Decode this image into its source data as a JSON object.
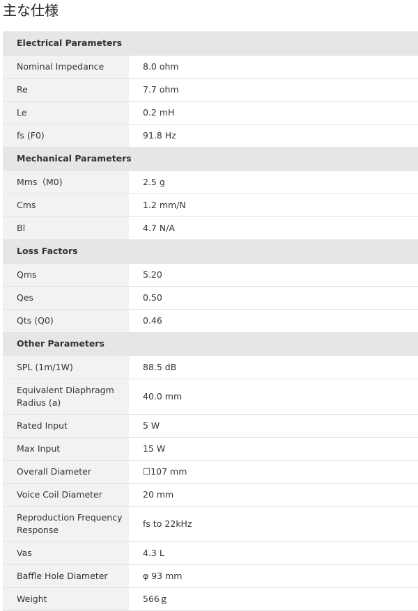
{
  "page": {
    "title": "主な仕様"
  },
  "sections": [
    {
      "heading": "Electrical Parameters",
      "rows": [
        {
          "label": "Nominal Impedance",
          "value": "8.0 ohm"
        },
        {
          "label": "Re",
          "value": "7.7 ohm"
        },
        {
          "label": "Le",
          "value": "0.2 mH"
        },
        {
          "label": "fs (F0)",
          "value": "91.8 Hz"
        }
      ]
    },
    {
      "heading": "Mechanical Parameters",
      "rows": [
        {
          "label": "Mms（M0)",
          "value": "2.5 g"
        },
        {
          "label": "Cms",
          "value": "1.2 mm/N"
        },
        {
          "label": "Bl",
          "value": "4.7 N/A"
        }
      ]
    },
    {
      "heading": "Loss Factors",
      "rows": [
        {
          "label": "Qms",
          "value": "5.20"
        },
        {
          "label": "Qes",
          "value": "0.50"
        },
        {
          "label": "Qts (Q0)",
          "value": "0.46"
        }
      ]
    },
    {
      "heading": "Other Parameters",
      "rows": [
        {
          "label": "SPL (1m/1W)",
          "value": "88.5 dB"
        },
        {
          "label": "Equivalent Diaphragm Radius (a)",
          "value": "40.0 mm"
        },
        {
          "label": "Rated Input",
          "value": "5 W"
        },
        {
          "label": "Max Input",
          "value": "15 W"
        },
        {
          "label": "Overall Diameter",
          "value": "☐107 mm"
        },
        {
          "label": "Voice Coil Diameter",
          "value": "20 mm"
        },
        {
          "label": "Reproduction Frequency Response",
          "value": "fs to 22kHz"
        },
        {
          "label": "Vas",
          "value": "4.3 L"
        },
        {
          "label": "Baffle Hole Diameter",
          "value": "φ 93 mm"
        },
        {
          "label": "Weight",
          "value": "566ｇ"
        }
      ]
    }
  ]
}
